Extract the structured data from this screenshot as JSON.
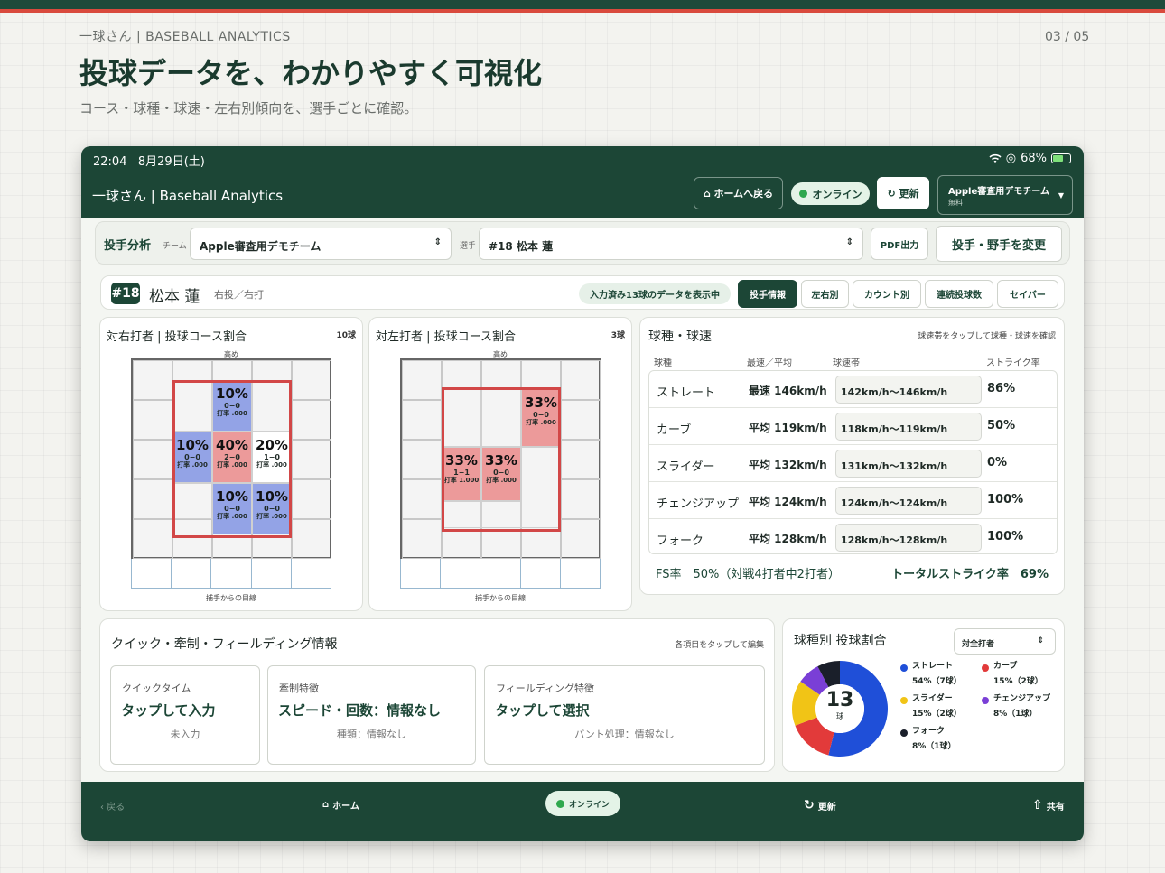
{
  "slide": {
    "brand": "一球さん | BASEBALL ANALYTICS",
    "page": "03 / 05",
    "title": "投球データを、わかりやすく可視化",
    "subtitle": "コース・球種・球速・左右別傾向を、選手ごとに確認。"
  },
  "status": {
    "time": "22:04",
    "date": "8月29日(土)",
    "battery": "68%"
  },
  "appbar": {
    "title": "一球さん | Baseball Analytics",
    "home": "⌂ ホームへ戻る",
    "online": "オンライン",
    "refresh": "↻ 更新",
    "team": "Apple審査用デモチーム",
    "plan": "無料"
  },
  "filter": {
    "section": "投手分析",
    "team_label": "チーム",
    "team": "Apple審査用デモチーム",
    "player_label": "選手",
    "player": "#18 松本 蓮",
    "pdf": "PDF出力",
    "change": "投手・野手を変更"
  },
  "player": {
    "number": "#18",
    "name": "松本 蓮",
    "hand": "右投／右打",
    "data_note": "入力済み13球のデータを表示中",
    "tabs": [
      "投手情報",
      "左右別",
      "カウント別",
      "連続投球数",
      "セイバー"
    ]
  },
  "zone_right": {
    "title": "対右打者 | 投球コース割合",
    "count": "10球",
    "high": "高め",
    "caption": "捕手からの目線",
    "cells": [
      {
        "pct": "10%",
        "count": "0−0",
        "avg": "打率 .000",
        "color": "blue"
      },
      {
        "pct": "10%",
        "count": "0−0",
        "avg": "打率 .000",
        "color": "blue"
      },
      {
        "pct": "40%",
        "count": "2−0",
        "avg": "打率 .000",
        "color": "red"
      },
      {
        "pct": "20%",
        "count": "1−0",
        "avg": "打率 .000",
        "color": "white"
      },
      {
        "pct": "10%",
        "count": "0−0",
        "avg": "打率 .000",
        "color": "blue"
      },
      {
        "pct": "10%",
        "count": "0−0",
        "avg": "打率 .000",
        "color": "blue"
      }
    ]
  },
  "zone_left": {
    "title": "対左打者 | 投球コース割合",
    "count": "3球",
    "high": "高め",
    "caption": "捕手からの目線",
    "cells": [
      {
        "pct": "33%",
        "count": "0−0",
        "avg": "打率 .000",
        "color": "red"
      },
      {
        "pct": "33%",
        "count": "1−1",
        "avg": "打率 1.000",
        "color": "red"
      },
      {
        "pct": "33%",
        "count": "0−0",
        "avg": "打率 .000",
        "color": "red"
      }
    ]
  },
  "speed": {
    "title": "球種・球速",
    "hint": "球速帯をタップして球種・球速を確認",
    "headers": [
      "球種",
      "最速／平均",
      "球速帯",
      "ストライク率"
    ],
    "rows": [
      {
        "type": "ストレート",
        "speed": "最速 146km/h",
        "band": "142km/h〜146km/h",
        "strike": "86%"
      },
      {
        "type": "カーブ",
        "speed": "平均 119km/h",
        "band": "118km/h〜119km/h",
        "strike": "50%"
      },
      {
        "type": "スライダー",
        "speed": "平均 132km/h",
        "band": "131km/h〜132km/h",
        "strike": "0%"
      },
      {
        "type": "チェンジアップ",
        "speed": "平均 124km/h",
        "band": "124km/h〜124km/h",
        "strike": "100%"
      },
      {
        "type": "フォーク",
        "speed": "平均 128km/h",
        "band": "128km/h〜128km/h",
        "strike": "100%"
      }
    ],
    "fs": "FS率　50%（対戦4打者中2打者）",
    "total": "トータルストライク率　69%"
  },
  "quick": {
    "title": "クイック・牽制・フィールディング情報",
    "hint": "各項目をタップして編集",
    "boxes": [
      {
        "label": "クイックタイム",
        "value": "タップして入力",
        "sub": "未入力"
      },
      {
        "label": "牽制特徴",
        "value": "スピード・回数：情報なし",
        "sub": "種類：情報なし"
      },
      {
        "label": "フィールディング特徴",
        "value": "タップして選択",
        "sub": "バント処理：情報なし"
      }
    ]
  },
  "mix": {
    "title": "球種別 投球割合",
    "select": "対全打者",
    "total": "13",
    "unit": "球",
    "legend": [
      {
        "name": "ストレート",
        "detail": "54%（7球）",
        "color": "#1f4fd8"
      },
      {
        "name": "カーブ",
        "detail": "15%（2球）",
        "color": "#e23a3a"
      },
      {
        "name": "スライダー",
        "detail": "15%（2球）",
        "color": "#f1c416"
      },
      {
        "name": "チェンジアップ",
        "detail": "8%（1球）",
        "color": "#7a3fd6"
      },
      {
        "name": "フォーク",
        "detail": "8%（1球）",
        "color": "#1a1f2a"
      }
    ],
    "chart_data": {
      "type": "pie",
      "categories": [
        "ストレート",
        "カーブ",
        "スライダー",
        "チェンジアップ",
        "フォーク"
      ],
      "values": [
        7,
        2,
        2,
        1,
        1
      ]
    }
  },
  "nav": {
    "back": "‹ 戻る",
    "home": "ホーム",
    "online": "オンライン",
    "refresh": "更新",
    "share": "共有"
  }
}
